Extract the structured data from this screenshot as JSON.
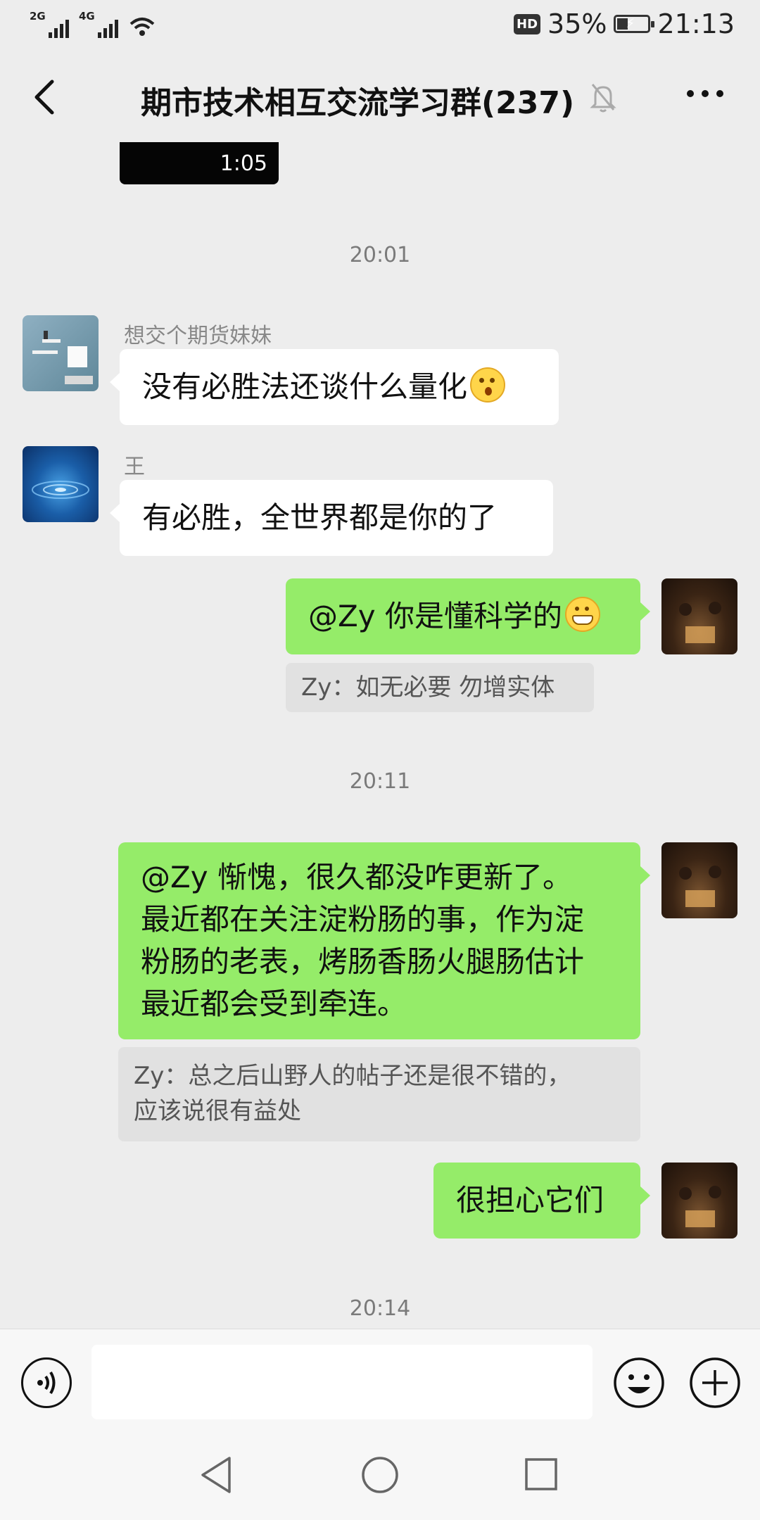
{
  "status_bar": {
    "sim1": "2G",
    "sim2": "4G",
    "hd": "HD",
    "battery": "35%",
    "battery_level": 0.35,
    "time": "21:13"
  },
  "header": {
    "title": "期市技术相互交流学习群(237)"
  },
  "chat": {
    "video_duration": "1:05",
    "time_1": "20:01",
    "msg1": {
      "sender": "想交个期货妹妹",
      "text": "没有必胜法还谈什么量化",
      "emoji": "astonished-emoji"
    },
    "msg2": {
      "sender": "王",
      "text": "有必胜，全世界都是你的了"
    },
    "msg3": {
      "text": "@Zy 你是懂科学的",
      "emoji": "grin-emoji",
      "quote": "Zy：如无必要 勿增实体"
    },
    "time_2": "20:11",
    "msg4": {
      "line1": "@Zy 惭愧，很久都没咋更新了。",
      "line2": "最近都在关注淀粉肠的事，作为淀",
      "line3": "粉肠的老表，烤肠香肠火腿肠估计",
      "line4": "最近都会受到牵连。",
      "quote_line1": "Zy：总之后山野人的帖子还是很不错的，",
      "quote_line2": "应该说很有益处"
    },
    "msg5": {
      "text": "很担心它们"
    },
    "time_3": "20:14"
  },
  "input_bar": {
    "text_value": ""
  }
}
